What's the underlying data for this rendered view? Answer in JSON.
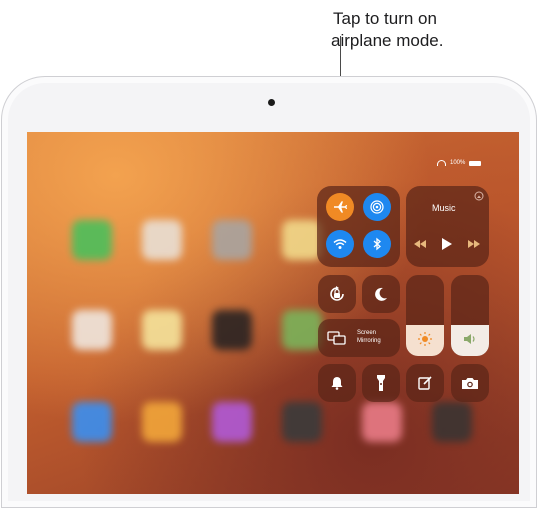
{
  "callout": {
    "line1": "Tap to turn on",
    "line2": "airplane mode."
  },
  "status_bar": {
    "battery_text": "100%",
    "icons": [
      "wifi-icon",
      "battery-icon"
    ]
  },
  "control_center": {
    "connectivity": [
      "airplane-icon",
      "airdrop-icon",
      "wifi-icon",
      "bluetooth-icon"
    ],
    "music": {
      "title": "Music",
      "controls": [
        "rewind-icon",
        "play-icon",
        "fast-forward-icon",
        "airplay-icon"
      ]
    },
    "toggles": [
      "orientation-lock-icon",
      "do-not-disturb-icon"
    ],
    "screen_mirroring": {
      "label": "Screen Mirroring",
      "label_line1": "Screen",
      "label_line2": "Mirroring"
    },
    "sliders": {
      "brightness_level": 0.38,
      "volume_level": 0.38
    },
    "bottom_row": [
      "bell-icon",
      "flashlight-icon",
      "notes-icon",
      "camera-icon"
    ],
    "colors": {
      "airplane_active": "#f08a24",
      "blue_active": "#1e88f0",
      "panel": "#5c2618",
      "slider_fill": "#f5e0cf"
    }
  }
}
